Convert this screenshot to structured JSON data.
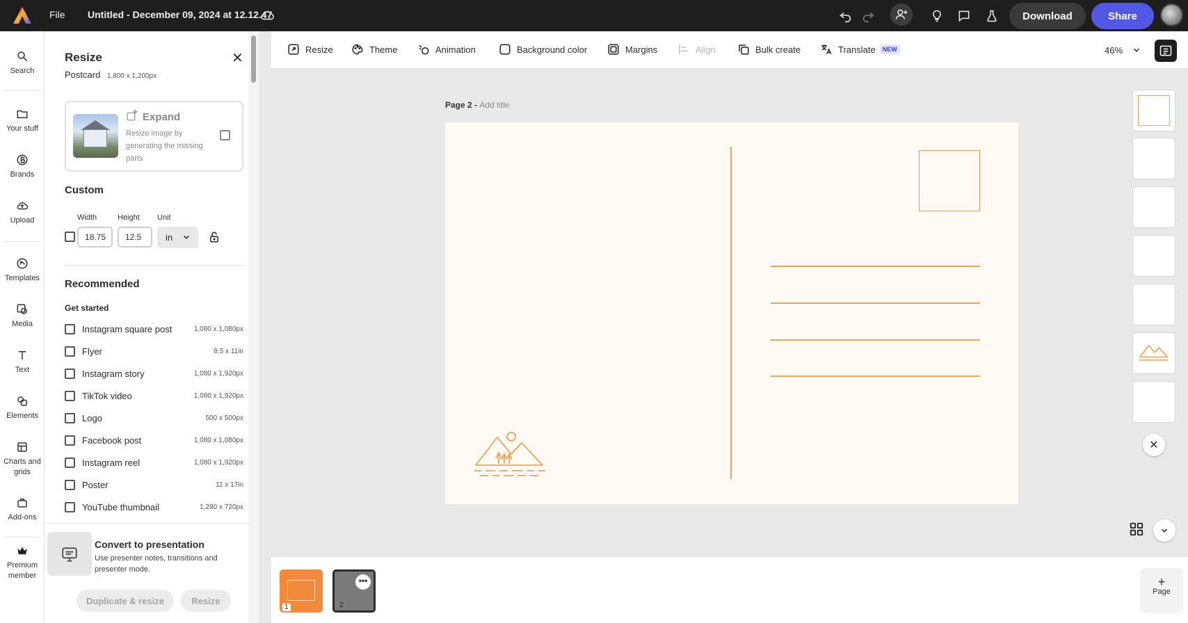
{
  "header": {
    "file_label": "File",
    "doc_title": "Untitled - December 09, 2024 at 12.12.47",
    "download_label": "Download",
    "share_label": "Share"
  },
  "rail": {
    "items": [
      {
        "label": "Search",
        "icon": "search-icon"
      },
      {
        "label": "Your stuff",
        "icon": "folder-icon"
      },
      {
        "label": "Brands",
        "icon": "brand-icon"
      },
      {
        "label": "Upload",
        "icon": "upload-icon"
      },
      {
        "label": "Templates",
        "icon": "templates-icon"
      },
      {
        "label": "Media",
        "icon": "media-icon"
      },
      {
        "label": "Text",
        "icon": "text-icon"
      },
      {
        "label": "Elements",
        "icon": "elements-icon"
      },
      {
        "label": "Charts and grids",
        "icon": "charts-icon"
      },
      {
        "label": "Add-ons",
        "icon": "addons-icon"
      },
      {
        "label": "Premium member",
        "icon": "crown-icon"
      }
    ]
  },
  "panel": {
    "title": "Resize",
    "format": "Postcard",
    "format_size": "1,800 x 1,200px",
    "expand": {
      "title": "Expand",
      "desc": "Resize image by generating the missing parts"
    },
    "custom": {
      "title": "Custom",
      "width_label": "Width",
      "height_label": "Height",
      "unit_label": "Unit",
      "width": "18.75",
      "height": "12.5",
      "unit": "in"
    },
    "recommended_title": "Recommended",
    "get_started_title": "Get started",
    "presets": [
      {
        "name": "Instagram square post",
        "size": "1,080 x 1,080px"
      },
      {
        "name": "Flyer",
        "size": "8.5 x 11in"
      },
      {
        "name": "Instagram story",
        "size": "1,080 x 1,920px"
      },
      {
        "name": "TikTok video",
        "size": "1,080 x 1,920px"
      },
      {
        "name": "Logo",
        "size": "500 x 500px"
      },
      {
        "name": "Facebook post",
        "size": "1,080 x 1,080px"
      },
      {
        "name": "Instagram reel",
        "size": "1,080 x 1,920px"
      },
      {
        "name": "Poster",
        "size": "11 x 17in"
      },
      {
        "name": "YouTube thumbnail",
        "size": "1,280 x 720px"
      }
    ],
    "convert": {
      "title": "Convert to presentation",
      "desc": "Use presenter notes, transitions and presenter mode."
    },
    "duplicate_label": "Duplicate & resize",
    "resize_label": "Resize"
  },
  "toolbar": {
    "resize": "Resize",
    "theme": "Theme",
    "animation": "Animation",
    "background": "Background color",
    "margins": "Margins",
    "align": "Align",
    "bulk": "Bulk create",
    "translate": "Translate",
    "translate_badge": "NEW",
    "zoom": "46%"
  },
  "canvas": {
    "page_label": "Page 2 -",
    "page_title_placeholder": "Add title",
    "accent_color": "#e7a55c"
  },
  "bottom": {
    "page1_num": "1",
    "page2_num": "2",
    "add_page_label": "Page"
  }
}
